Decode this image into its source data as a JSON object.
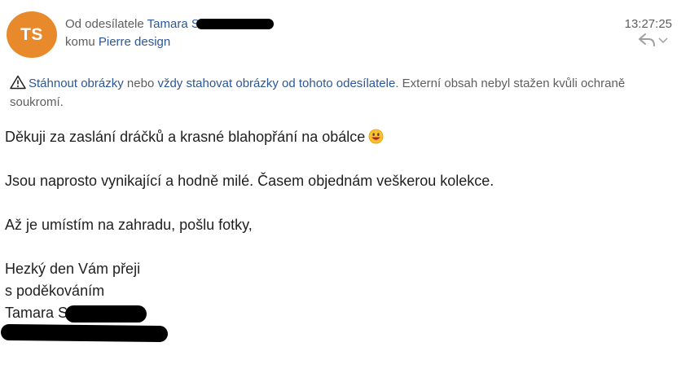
{
  "header": {
    "avatar_initials": "TS",
    "avatar_color": "#e8892b",
    "from_prefix": "Od odesílatele",
    "from_name": "Tamara S",
    "to_prefix": "komu",
    "to_name": "Pierre design",
    "time": "13:27:25",
    "reply_icon": "reply-icon",
    "more_icon": "chevron-down-icon"
  },
  "infobar": {
    "icon": "warning-icon",
    "download_link": "Stáhnout obrázky",
    "conjunction": " nebo ",
    "always_link": "vždy stahovat obrázky od tohoto odesílatele",
    "message": ". Externí obsah nebyl stažen kvůli ochraně soukromí."
  },
  "body": {
    "line1": "Děkuji za zaslání dráčků a krasné blahopřání na obálce",
    "line2": "Jsou naprosto vynikající a hodně milé.  Časem objednám veškerou kolekce.",
    "line3": "Až je umístím na zahradu, pošlu fotky,",
    "line4": "Hezký den Vám přeji",
    "line5": "s poděkováním",
    "line6": "Tamara S"
  },
  "colors": {
    "link": "#2b579a",
    "secondary_text": "#605e5c"
  }
}
